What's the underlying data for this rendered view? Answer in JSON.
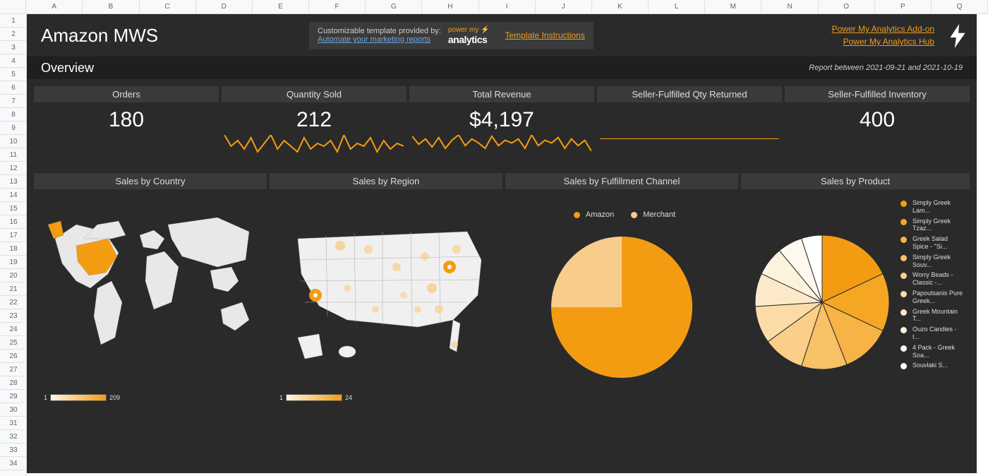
{
  "columns": [
    "A",
    "B",
    "C",
    "D",
    "E",
    "F",
    "G",
    "H",
    "I",
    "J",
    "K",
    "L",
    "M",
    "N",
    "O",
    "P",
    "Q"
  ],
  "rows": [
    "1",
    "2",
    "3",
    "4",
    "5",
    "6",
    "7",
    "8",
    "9",
    "10",
    "11",
    "12",
    "13",
    "14",
    "15",
    "16",
    "17",
    "18",
    "19",
    "20",
    "21",
    "22",
    "23",
    "24",
    "25",
    "26",
    "27",
    "28",
    "29",
    "30",
    "31",
    "32",
    "33",
    "34"
  ],
  "header": {
    "title": "Amazon MWS",
    "template_label": "Customizable template provided by:",
    "automate_link": "Automate your marketing reports",
    "logo_small": "power my",
    "logo_big": "analytics",
    "template_instructions": "Template Instructions",
    "link_addon": "Power My Analytics Add-on",
    "link_hub": "Power My Analytics Hub"
  },
  "overview": {
    "label": "Overview",
    "range": "Report between 2021-09-21 and 2021-10-19"
  },
  "metrics": [
    {
      "label": "Orders",
      "value": "180"
    },
    {
      "label": "Quantity Sold",
      "value": "212"
    },
    {
      "label": "Total Revenue",
      "value": "$4,197"
    },
    {
      "label": "Seller-Fulfilled Qty Returned",
      "value": ""
    },
    {
      "label": "Seller-Fulfilled Inventory",
      "value": "400"
    }
  ],
  "charts": {
    "country": {
      "title": "Sales by Country",
      "scale_min": "1",
      "scale_max": "209"
    },
    "region": {
      "title": "Sales by Region",
      "scale_min": "1",
      "scale_max": "24"
    },
    "channel": {
      "title": "Sales by Fulfillment Channel",
      "legend": [
        {
          "label": "Amazon",
          "color": "#f39c12"
        },
        {
          "label": "Merchant",
          "color": "#f8cd8c"
        }
      ]
    },
    "product": {
      "title": "Sales by Product",
      "legend": [
        {
          "label": "Simply Greek Lam...",
          "color": "#f39c12"
        },
        {
          "label": "Simply Greek Tzaz...",
          "color": "#f5a623"
        },
        {
          "label": "Greek Salad Spice - \"Si...",
          "color": "#f7b345"
        },
        {
          "label": "Simply Greek Souv...",
          "color": "#f8c166"
        },
        {
          "label": "Worry Beads - Classic -...",
          "color": "#facf88"
        },
        {
          "label": "Papoutsanis Pure Greek...",
          "color": "#fbdca9"
        },
        {
          "label": "Greek Mountain T...",
          "color": "#fce9ca"
        },
        {
          "label": "Ouzo Candies - I...",
          "color": "#fdf2de"
        },
        {
          "label": "4 Pack - Greek Soa...",
          "color": "#fef8ef"
        },
        {
          "label": "Souvlaki S...",
          "color": "#ffffff"
        }
      ]
    }
  },
  "chart_data": [
    {
      "type": "line",
      "title": "Quantity Sold sparkline",
      "values": [
        10,
        6,
        8,
        5,
        9,
        4,
        7,
        10,
        5,
        8,
        6,
        4,
        9,
        5,
        7,
        6,
        8,
        4,
        10,
        5,
        7,
        6,
        9,
        4,
        8,
        5,
        7,
        6
      ],
      "ylim": [
        0,
        12
      ]
    },
    {
      "type": "line",
      "title": "Total Revenue sparkline",
      "values": [
        200,
        140,
        180,
        120,
        190,
        110,
        170,
        210,
        130,
        180,
        150,
        110,
        200,
        130,
        170,
        150,
        180,
        110,
        210,
        130,
        170,
        150,
        190,
        110,
        180,
        130,
        170,
        90
      ],
      "ylim": [
        0,
        250
      ]
    },
    {
      "type": "line",
      "title": "Seller-Fulfilled Qty Returned sparkline",
      "values": [
        0,
        0,
        0,
        0,
        0,
        0,
        0,
        0,
        0,
        0,
        0,
        0,
        0,
        0,
        0,
        0,
        0,
        0,
        0,
        0,
        0,
        0,
        0,
        0,
        0,
        0,
        0,
        0
      ],
      "ylim": [
        0,
        1
      ]
    },
    {
      "type": "pie",
      "title": "Sales by Fulfillment Channel",
      "series": [
        {
          "name": "Amazon",
          "value": 75
        },
        {
          "name": "Merchant",
          "value": 25
        }
      ]
    },
    {
      "type": "pie",
      "title": "Sales by Product",
      "series": [
        {
          "name": "Simply Greek Lam...",
          "value": 18
        },
        {
          "name": "Simply Greek Tzaz...",
          "value": 14
        },
        {
          "name": "Greek Salad Spice",
          "value": 12
        },
        {
          "name": "Simply Greek Souv...",
          "value": 11
        },
        {
          "name": "Worry Beads",
          "value": 10
        },
        {
          "name": "Papoutsanis",
          "value": 9
        },
        {
          "name": "Greek Mountain T...",
          "value": 8
        },
        {
          "name": "Ouzo Candies",
          "value": 7
        },
        {
          "name": "4 Pack Greek Soa...",
          "value": 6
        },
        {
          "name": "Souvlaki S...",
          "value": 5
        }
      ]
    }
  ]
}
